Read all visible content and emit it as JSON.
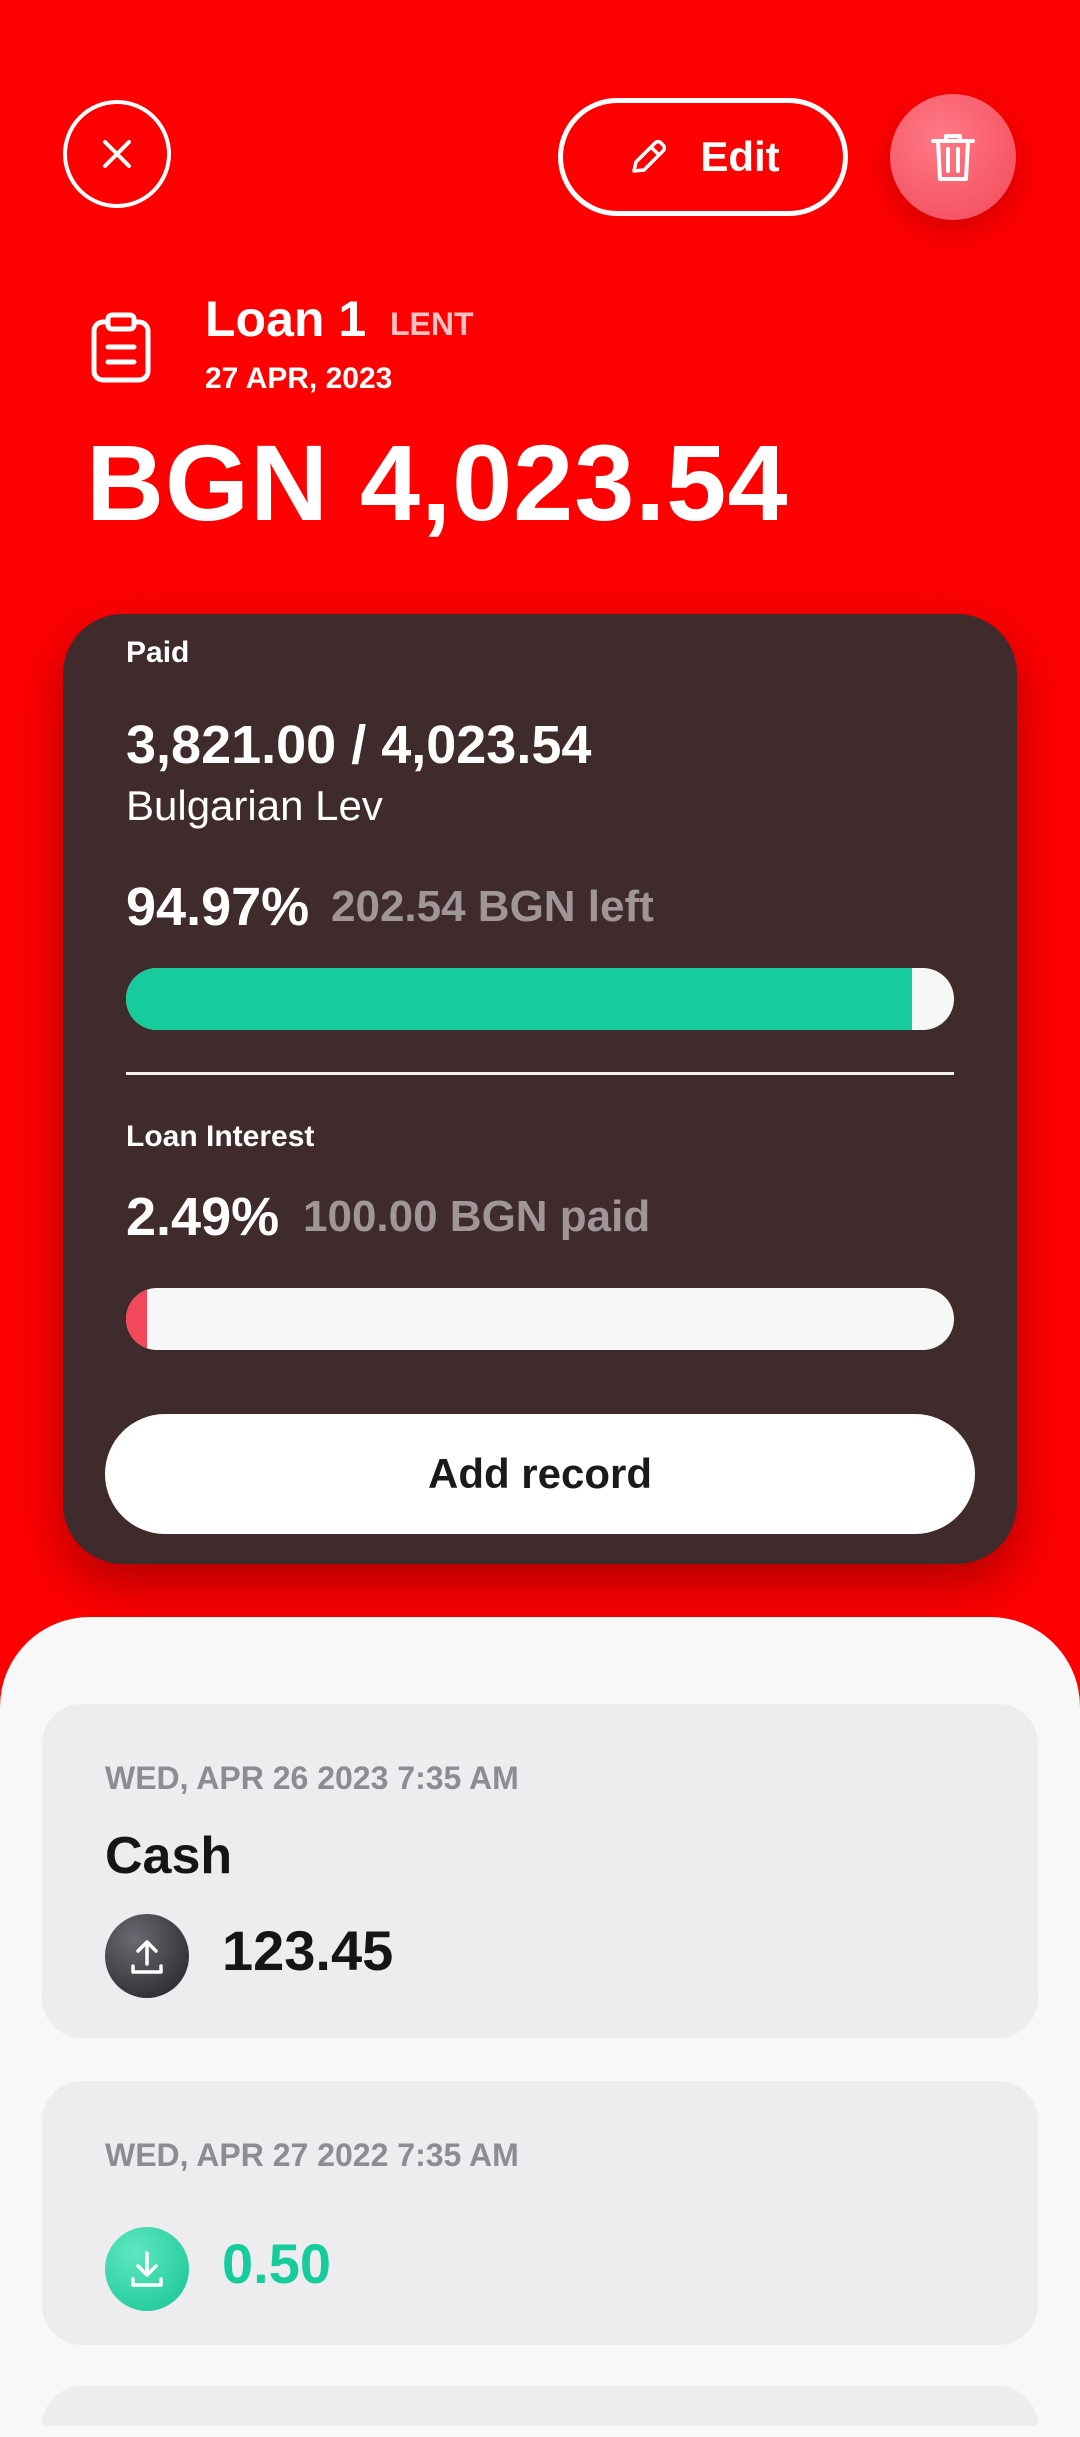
{
  "header": {
    "edit_label": "Edit",
    "close_icon": "close-icon",
    "edit_icon": "pencil-icon",
    "delete_icon": "trash-icon"
  },
  "loan": {
    "icon": "clipboard-icon",
    "title": "Loan 1",
    "type": "LENT",
    "date": "27 APR, 2023",
    "amount": "BGN 4,023.54"
  },
  "summary": {
    "paid_label": "Paid",
    "paid_ratio": "3,821.00 / 4,023.54",
    "currency_name": "Bulgarian Lev",
    "paid_percent": "94.97%",
    "left_text": "202.54 BGN left",
    "paid_progress": 0.9497,
    "interest_label": "Loan Interest",
    "interest_percent": "2.49%",
    "interest_paid_text": "100.00 BGN paid",
    "interest_progress": 0.0249,
    "add_record_label": "Add record"
  },
  "records": [
    {
      "date": "WED, APR 26 2023 7:35 AM",
      "title": "Cash",
      "amount": "123.45",
      "direction": "upload-icon"
    },
    {
      "date": "WED, APR 27 2022 7:35 AM",
      "title": "",
      "amount": "0.50",
      "direction": "download-icon"
    }
  ],
  "colors": {
    "background": "#ff0000",
    "card": "#3f2a2c",
    "progress_paid": "#17cc9c",
    "progress_interest": "#f2485a",
    "delete_button": "#f2485a",
    "income_amount": "#17cc9c"
  }
}
